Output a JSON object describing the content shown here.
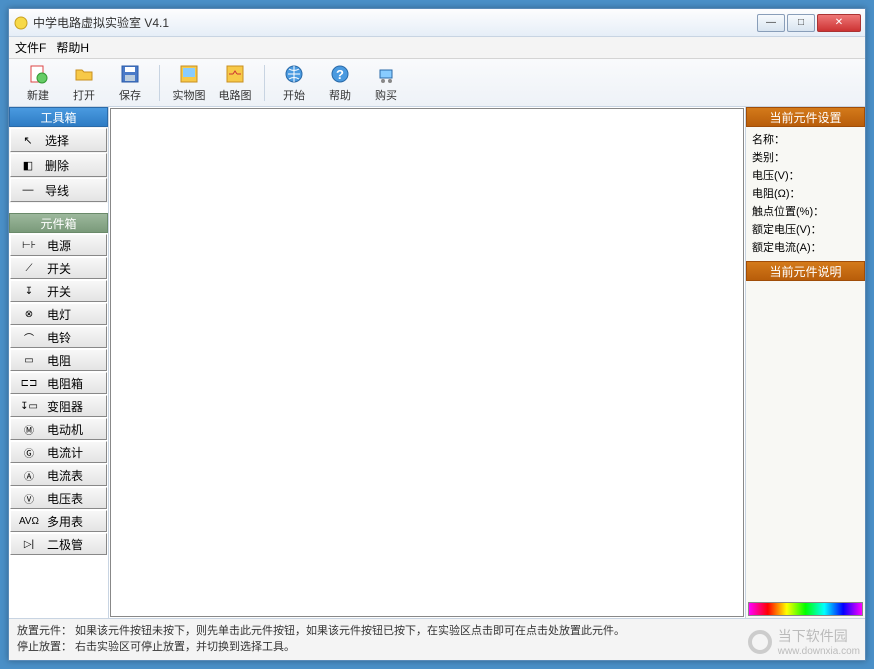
{
  "window": {
    "title": "中学电路虚拟实验室 V4.1"
  },
  "menu": {
    "file": "文件F",
    "help": "帮助H"
  },
  "toolbar": {
    "new": "新建",
    "open": "打开",
    "save": "保存",
    "photo": "实物图",
    "circuit": "电路图",
    "start": "开始",
    "help": "帮助",
    "buy": "购买"
  },
  "toolbox": {
    "header": "工具箱",
    "items": [
      {
        "label": "选择",
        "sym": "↖"
      },
      {
        "label": "删除",
        "sym": "◧"
      },
      {
        "label": "导线",
        "sym": "—"
      }
    ]
  },
  "compbox": {
    "header": "元件箱",
    "items": [
      {
        "label": "电源",
        "sym": "⊢⊦"
      },
      {
        "label": "开关",
        "sym": "⟋"
      },
      {
        "label": "开关",
        "sym": "↧"
      },
      {
        "label": "电灯",
        "sym": "⊗"
      },
      {
        "label": "电铃",
        "sym": "⌒"
      },
      {
        "label": "电阻",
        "sym": "▭"
      },
      {
        "label": "电阻箱",
        "sym": "⊏⊐"
      },
      {
        "label": "变阻器",
        "sym": "↧▭"
      },
      {
        "label": "电动机",
        "sym": "Ⓜ"
      },
      {
        "label": "电流计",
        "sym": "Ⓖ"
      },
      {
        "label": "电流表",
        "sym": "Ⓐ"
      },
      {
        "label": "电压表",
        "sym": "Ⓥ"
      },
      {
        "label": "多用表",
        "sym": "AVΩ"
      },
      {
        "label": "二极管",
        "sym": "▷|"
      }
    ]
  },
  "right": {
    "settings_header": "当前元件设置",
    "props": {
      "name": "名称：",
      "category": "类别：",
      "voltage": "电压(V)：",
      "resistance": "电阻(Ω)：",
      "contact": "触点位置(%)：",
      "rated_v": "额定电压(V)：",
      "rated_a": "额定电流(A)："
    },
    "desc_header": "当前元件说明"
  },
  "status": {
    "line1": "放置元件：  如果该元件按钮未按下，则先单击此元件按钮，如果该元件按钮已按下，在实验区点击即可在点击处放置此元件。",
    "line2": "停止放置：  右击实验区可停止放置，并切换到选择工具。"
  },
  "watermark": {
    "brand": "当下软件园",
    "url": "www.downxia.com"
  }
}
